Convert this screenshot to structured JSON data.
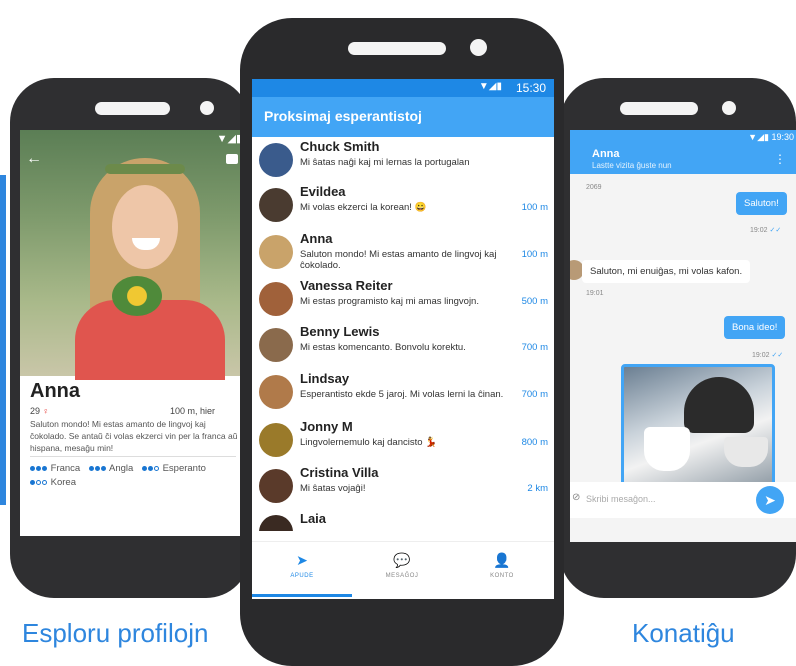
{
  "left_phone": {
    "name": "Anna",
    "age": "29",
    "distance": "100 m, hier",
    "bio": "Saluton mondo! Mi estas amanto de lingvoj kaj ĉokolado. Se antaŭ ĉi volas ekzerci vin per la franca aŭ hispana, mesaĝu min!",
    "languages": [
      {
        "name": "Franca",
        "level": 3
      },
      {
        "name": "Angla",
        "level": 3
      },
      {
        "name": "Esperanto",
        "level": 2
      },
      {
        "name": "Korea",
        "level": 1
      }
    ],
    "caption": "Esploru profilojn"
  },
  "center_phone": {
    "status_time": "15:30",
    "app_title": "Proksimaj esperantistoj",
    "contacts": [
      {
        "name": "Chuck Smith",
        "message": "Mi ŝatas naĝi kaj mi lernas la portugalan",
        "distance": "",
        "avatar_color": "#3a5b8c"
      },
      {
        "name": "Evildea",
        "message": "Mi volas ekzerci la korean! 😀",
        "distance": "100 m",
        "avatar_color": "#4a3b30"
      },
      {
        "name": "Anna",
        "message": "Saluton mondo! Mi estas amanto de lingvoj kaj ĉokolado.",
        "distance": "100 m",
        "avatar_color": "#c9a36a"
      },
      {
        "name": "Vanessa Reiter",
        "message": "Mi estas programisto kaj mi amas lingvojn.",
        "distance": "500 m",
        "avatar_color": "#a0613a"
      },
      {
        "name": "Benny Lewis",
        "message": "Mi estas komencanto. Bonvolu korektu.",
        "distance": "700 m",
        "avatar_color": "#8a6a4c"
      },
      {
        "name": "Lindsay",
        "message": "Esperantisto ekde 5 jaroj. Mi volas lerni la ĉinan.",
        "distance": "700 m",
        "avatar_color": "#b07a4a"
      },
      {
        "name": "Jonny M",
        "message": "Lingvolernemulo kaj dancisto 💃",
        "distance": "800 m",
        "avatar_color": "#9a7a2a"
      },
      {
        "name": "Cristina Villa",
        "message": "Mi ŝatas vojaĝi!",
        "distance": "2 km",
        "avatar_color": "#5a3a2a"
      },
      {
        "name": "Laia",
        "message": "",
        "distance": "",
        "avatar_color": "#3a2a22"
      }
    ],
    "nav": [
      {
        "label": "APUDE",
        "icon": "➤"
      },
      {
        "label": "MESAĜOJ",
        "icon": "💬"
      },
      {
        "label": "KONTO",
        "icon": "👤"
      }
    ]
  },
  "right_phone": {
    "status_time": "19:30",
    "chat_name": "Anna",
    "chat_sub": "Lastte vizita ĝuste nun",
    "date_label": "2069",
    "msg1": "Saluton!",
    "msg1_time": "19:02",
    "msg2": "Saluton, mi enuiĝas, mi volas kafon.",
    "msg2_time": "19:01",
    "msg3": "Bona ideo!",
    "msg3_time": "19:02",
    "input_placeholder": "Skribi mesaĝon...",
    "caption": "Konatiĝu"
  }
}
